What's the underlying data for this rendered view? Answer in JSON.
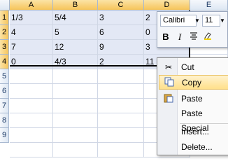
{
  "columns": [
    "A",
    "B",
    "C",
    "D",
    "E"
  ],
  "rows": [
    "1",
    "2",
    "3",
    "4",
    "5",
    "6",
    "7",
    "8",
    "9"
  ],
  "grid": [
    [
      "1/3",
      "5/4",
      "3",
      "2",
      ""
    ],
    [
      "4",
      "5",
      "6",
      "0",
      ""
    ],
    [
      "7",
      "12",
      "9",
      "3",
      ""
    ],
    [
      "0",
      "4/3",
      "2",
      "11",
      ""
    ]
  ],
  "mini_toolbar": {
    "font_name": "Calibri",
    "font_size": "11",
    "bold": "B",
    "italic": "I"
  },
  "context_menu": {
    "items": [
      {
        "label": "Cut",
        "icon": "scissors-icon"
      },
      {
        "label": "Copy",
        "icon": "copy-icon"
      },
      {
        "label": "Paste",
        "icon": "paste-icon"
      },
      {
        "label": "Paste Special",
        "icon": ""
      },
      {
        "label": "Insert...",
        "icon": ""
      },
      {
        "label": "Delete...",
        "icon": ""
      }
    ]
  },
  "colors": {
    "selection_fill": "#e3e8f5",
    "header_selected": "#f6c45a",
    "menu_highlight": "#ffe08a"
  }
}
